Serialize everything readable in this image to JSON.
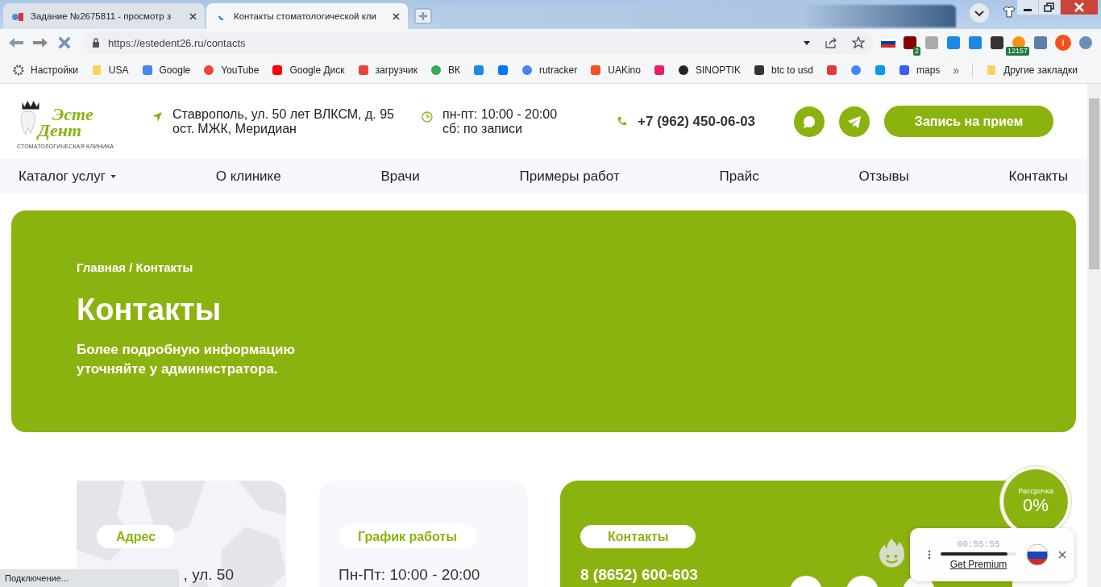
{
  "browser": {
    "tabs": [
      {
        "title": "Задание №2675811 - просмотр з",
        "selected": false,
        "loading": false
      },
      {
        "title": "Контакты стоматологической кли",
        "selected": true,
        "loading": true
      }
    ],
    "address": "https://estedent26.ru/contacts",
    "extensions": [
      {
        "kind": "flag"
      },
      {
        "kind": "shield",
        "badge": "2"
      },
      {
        "kind": "case"
      },
      {
        "kind": "funnel"
      },
      {
        "kind": "download"
      },
      {
        "kind": "dark"
      },
      {
        "kind": "coin",
        "badge": "12157"
      },
      {
        "kind": "puzzle"
      },
      {
        "kind": "avatar",
        "letter": "I"
      },
      {
        "kind": "gear"
      }
    ],
    "bookmarks": [
      {
        "kind": "link",
        "label": "Настройки"
      },
      {
        "kind": "link",
        "label": "USA"
      },
      {
        "kind": "link",
        "label": "Google"
      },
      {
        "kind": "link",
        "label": "YouTube"
      },
      {
        "kind": "link",
        "label": "Google Диск"
      },
      {
        "kind": "link",
        "label": "загрузчик"
      },
      {
        "kind": "link",
        "label": "ВК"
      },
      {
        "kind": "icon"
      },
      {
        "kind": "icon"
      },
      {
        "kind": "link",
        "label": "rutracker"
      },
      {
        "kind": "link",
        "label": "UAKino"
      },
      {
        "kind": "icon"
      },
      {
        "kind": "link",
        "label": "SINOPTIK"
      },
      {
        "kind": "link",
        "label": "btc to usd"
      },
      {
        "kind": "icon"
      },
      {
        "kind": "icon"
      },
      {
        "kind": "icon"
      },
      {
        "kind": "link",
        "label": "maps"
      }
    ],
    "more": "»",
    "other_bookmarks": "Другие закладки",
    "status": "Подключение..."
  },
  "header": {
    "logo": {
      "top": "Эсте",
      "bottom": "Дент",
      "tagline": "СТОМАТОЛОГИЧЕСКАЯ КЛИНИКА"
    },
    "address": [
      "Ставрополь, ул. 50 лет ВЛКСМ, д. 95",
      "ост. МЖК, Меридиан"
    ],
    "hours": [
      "пн-пт: 10:00 - 20:00",
      "сб: по записи"
    ],
    "phone": "+7 (962) 450-06-03",
    "cta": "Запись на прием"
  },
  "nav": [
    {
      "label": "Каталог услуг",
      "dropdown": true
    },
    {
      "label": "О клинике",
      "dropdown": false
    },
    {
      "label": "Врачи",
      "dropdown": false
    },
    {
      "label": "Примеры работ",
      "dropdown": false
    },
    {
      "label": "Прайс",
      "dropdown": false
    },
    {
      "label": "Отзывы",
      "dropdown": false
    },
    {
      "label": "Контакты",
      "dropdown": false
    }
  ],
  "hero": {
    "breadcrumb": "Главная / Контакты",
    "title": "Контакты",
    "subtitle": [
      "Более подробную информацию",
      "уточняйте у администратора."
    ]
  },
  "cards": [
    {
      "kind": "map",
      "label": "Адрес",
      "text": ", ул. 50"
    },
    {
      "kind": "plain",
      "label": "График работы",
      "text": "Пн-Пт: 10:00 - 20:00"
    },
    {
      "kind": "green",
      "label": "Контакты",
      "text": "8 (8652) 600-603"
    }
  ],
  "installment": {
    "label": "Рассрочка",
    "value": "0%"
  },
  "vpn": {
    "timer": "00:55:55",
    "level": 0.88,
    "link": "Get Premium"
  }
}
